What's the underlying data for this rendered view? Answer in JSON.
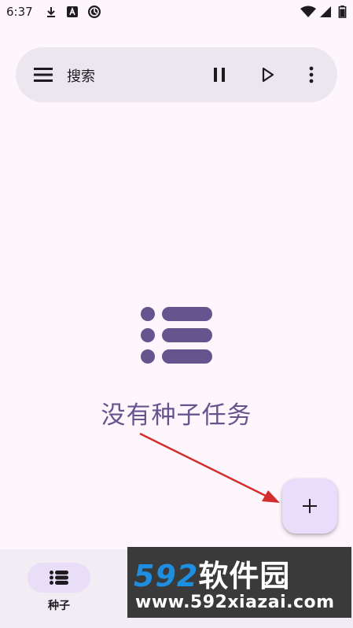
{
  "status_bar": {
    "time": "6:37",
    "left_icons": [
      "download-icon",
      "a-badge-icon",
      "sync-icon"
    ],
    "right_icons": [
      "wifi-icon",
      "cell-signal-icon",
      "battery-icon"
    ]
  },
  "search_bar": {
    "placeholder": "搜索",
    "menu_icon": "hamburger-menu-icon",
    "actions": [
      "pause-icon",
      "play-icon",
      "more-vert-icon"
    ]
  },
  "empty_state": {
    "icon": "list-icon",
    "message": "没有种子任务"
  },
  "fab": {
    "icon": "plus-icon"
  },
  "bottom_nav": {
    "items": [
      {
        "label": "种子",
        "icon": "list-icon",
        "selected": true
      }
    ]
  },
  "watermark": {
    "brand_digits": "592",
    "brand_text": "软件园",
    "url": "www.592xiazai.com"
  },
  "colors": {
    "background": "#fdf7fd",
    "search_bar": "#ece6ee",
    "accent": "#65558f",
    "fab": "#e9ddfb",
    "nav_bar": "#f2ecf4",
    "nav_indicator": "#e8def8",
    "annotation_arrow": "#d42d2d"
  }
}
